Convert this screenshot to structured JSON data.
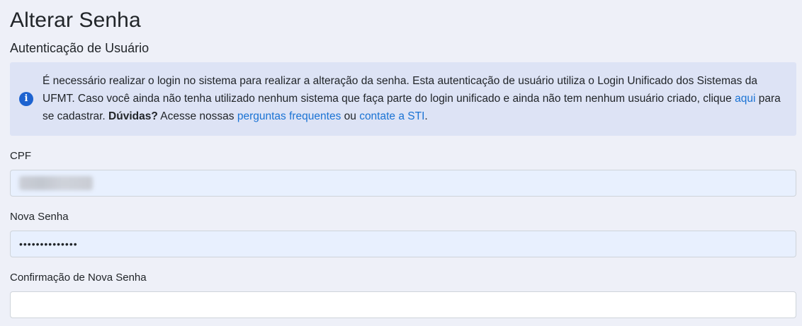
{
  "page": {
    "title": "Alterar Senha",
    "subtitle": "Autenticação de Usuário"
  },
  "alert": {
    "icon": "info-circle-icon",
    "text_1": "É necessário realizar o login no sistema para realizar a alteração da senha. Esta autenticação de usuário utiliza o Login Unificado dos Sistemas da UFMT. Caso você ainda não tenha utilizado nenhum sistema que faça parte do login unificado e ainda não tem nenhum usuário criado, clique ",
    "link_aqui": "aqui",
    "text_2": " para se cadastrar. ",
    "bold_duvidas": "Dúvidas?",
    "text_3": " Acesse nossas ",
    "link_faq": "perguntas frequentes",
    "text_4": " ou ",
    "link_contact": "contate a STI",
    "text_5": "."
  },
  "form": {
    "cpf_label": "CPF",
    "nova_senha_label": "Nova Senha",
    "nova_senha_value": "••••••••••••••",
    "confirmacao_label": "Confirmação de Nova Senha",
    "confirmacao_value": ""
  },
  "colors": {
    "background": "#eef0f8",
    "alert_bg": "#dde3f5",
    "link": "#1a73d4",
    "icon": "#1d63d0",
    "autofill_bg": "#e8f0fe"
  }
}
